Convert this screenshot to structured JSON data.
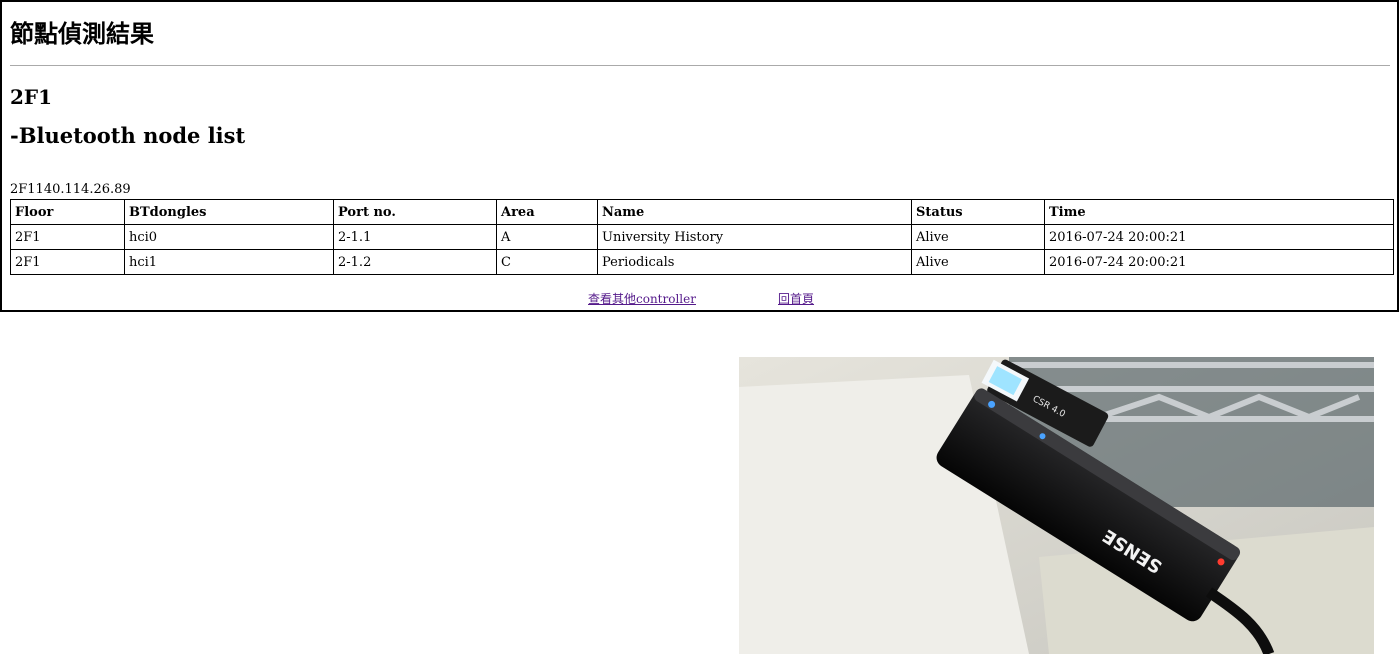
{
  "page": {
    "title": "節點偵測結果",
    "floor": "2F1",
    "list_heading": "-Bluetooth node list",
    "controller_label": "2F1140.114.26.89"
  },
  "table": {
    "headers": [
      "Floor",
      "BTdongles",
      "Port no.",
      "Area",
      "Name",
      "Status",
      "Time"
    ],
    "rows": [
      [
        "2F1",
        "hci0",
        "2-1.1",
        "A",
        "University History",
        "Alive",
        "2016-07-24 20:00:21"
      ],
      [
        "2F1",
        "hci1",
        "2-1.2",
        "C",
        "Periodicals",
        "Alive",
        "2016-07-24 20:00:21"
      ]
    ]
  },
  "links": {
    "other_controller": "查看其他controller",
    "home": "回首頁"
  },
  "photo": {
    "hub_brand": "SENSE",
    "dongle_label": "CSR 4.0"
  },
  "colors": {
    "link": "#551a8b",
    "led_blue": "#4aa3ff",
    "led_red": "#ff3b2f"
  }
}
